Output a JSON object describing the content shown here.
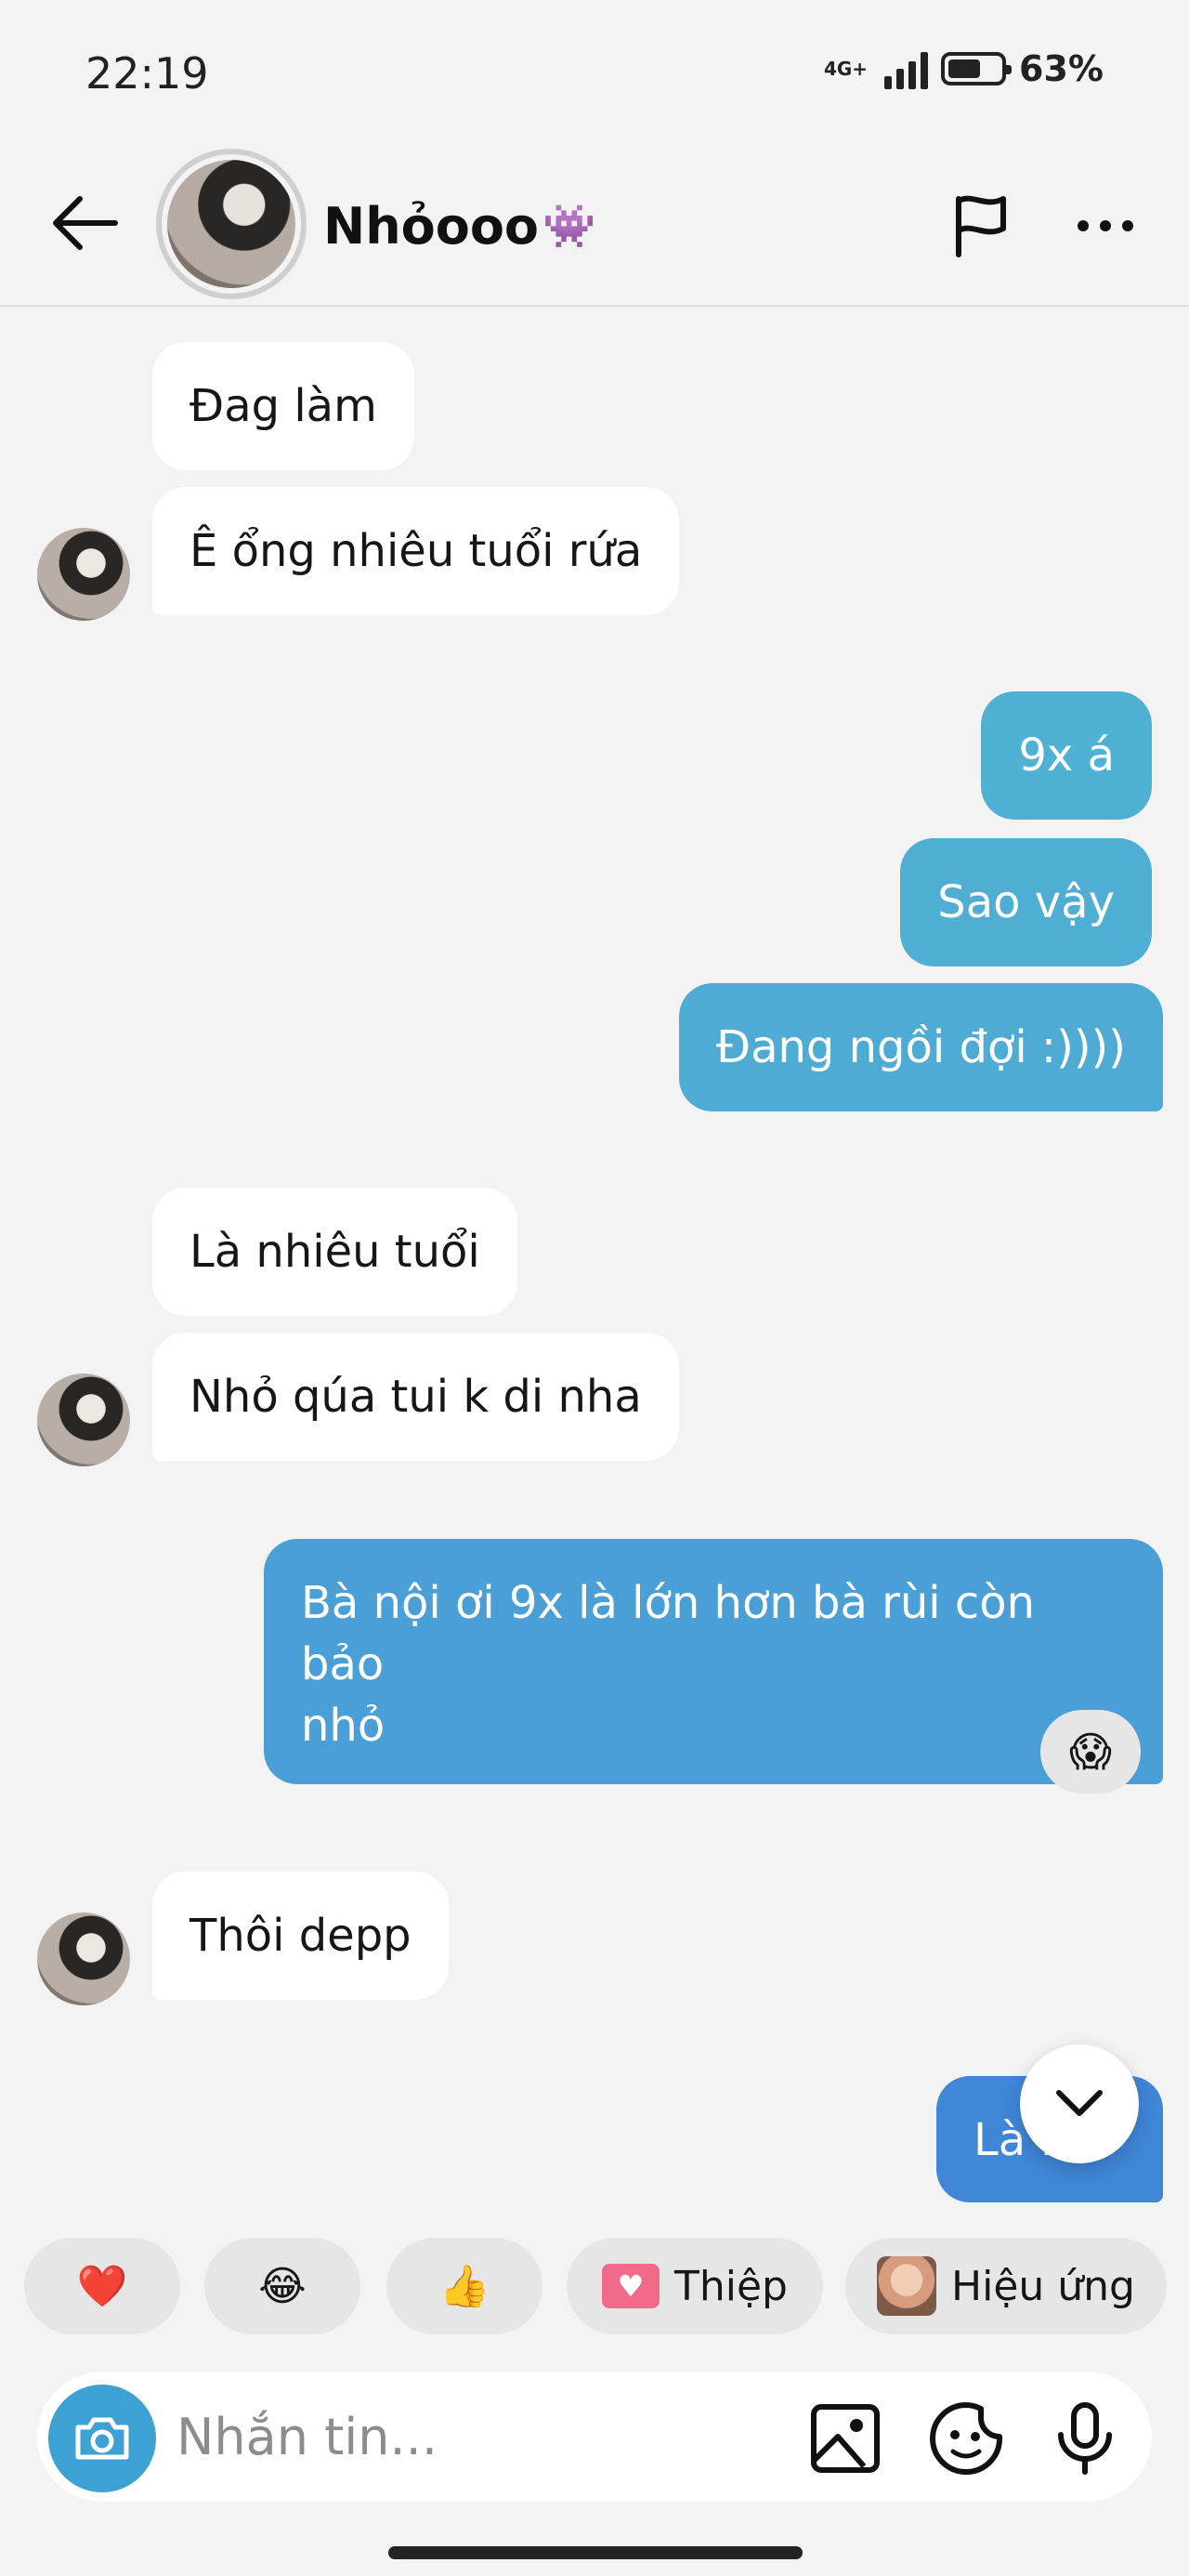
{
  "status": {
    "time": "22:19",
    "network": "4G+",
    "battery": "63%",
    "battery_level": 0.63
  },
  "header": {
    "name": "Nhỏooo",
    "name_emoji": "👾",
    "back_icon": "arrow-left-icon",
    "flag_icon": "flag-icon",
    "more_icon": "more-icon"
  },
  "messages": {
    "m1": "Đag làm",
    "m2": "Ê ổng nhiêu tuổi rứa",
    "m3": "9x á",
    "m4": "Sao vậy",
    "m5": "Đang ngồi đợi :))))",
    "m6": "Là nhiêu tuổi",
    "m7": "Nhỏ qúa tui k di nha",
    "m8_line1": "Bà nội ơi 9x là lớn hơn bà rùi còn bảo",
    "m8_line2": "nhỏ",
    "m8_reaction": "😱",
    "m9": "Thôi depp",
    "m10": "Là ..."
  },
  "quick_actions": {
    "heart": "❤️",
    "laugh": "😂",
    "thumbs": "👍",
    "card_label": "Thiệp",
    "effects_label": "Hiệu ứng"
  },
  "composer": {
    "placeholder": "Nhắn tin...",
    "camera_icon": "camera-icon",
    "gallery_icon": "image-icon",
    "sticker_icon": "sticker-icon",
    "mic_icon": "mic-icon"
  },
  "colors": {
    "bubble_out_light": "#4fb1d3",
    "bubble_out_mid": "#4a9fd6",
    "bubble_out_dark": "#3f86d7",
    "bubble_in": "#ffffff",
    "background": "#f3f3f3"
  }
}
